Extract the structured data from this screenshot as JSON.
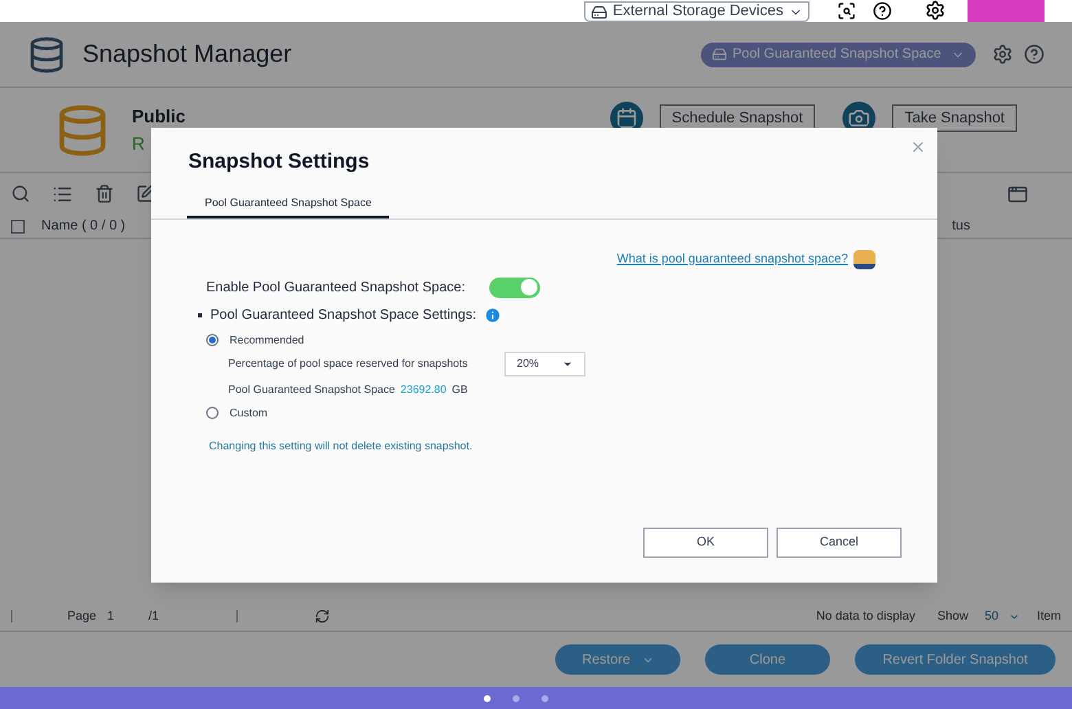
{
  "top_bar": {
    "storage_dropdown": "External Storage Devices"
  },
  "app": {
    "title": "Snapshot Manager",
    "pool_selector": "Pool Guaranteed Snapshot Space",
    "folder": {
      "name": "Public",
      "status": "R"
    },
    "buttons": [
      "Schedule Snapshot",
      "Take Snapshot"
    ],
    "table": {
      "select_all_checked": false,
      "columns": [
        "Name ( 0 / 0 )",
        "tus"
      ]
    },
    "pagination": {
      "page_label": "Page",
      "page": "1",
      "total": "/1",
      "status": "No data to display",
      "show_label": "Show",
      "show_value": "50",
      "items_label": "Item"
    },
    "actions": [
      {
        "label": "Restore",
        "dropdown": true
      },
      {
        "label": "Clone",
        "dropdown": false
      },
      {
        "label": "Revert Folder Snapshot",
        "dropdown": false
      }
    ]
  },
  "dialog": {
    "title": "Snapshot Settings",
    "tabs": [
      {
        "label": "Pool Guaranteed Snapshot Space",
        "selected": true
      }
    ],
    "help_link": "What is pool guaranteed snapshot space?",
    "enable": {
      "label": "Enable Pool Guaranteed Snapshot Space:",
      "on": true
    },
    "settings_label": "Pool Guaranteed Snapshot Space Settings:",
    "options": [
      {
        "label": "Recommended",
        "selected": true
      },
      {
        "label": "Custom",
        "selected": false
      }
    ],
    "percentage_label": "Percentage of pool space reserved for snapshots",
    "percentage_value": "20%",
    "space_label": "Pool Guaranteed Snapshot Space",
    "space_value": "23692.80",
    "space_unit": "GB",
    "note": "Changing this setting will not delete existing snapshot.",
    "buttons": [
      "OK",
      "Cancel"
    ]
  },
  "taskbar": {
    "pages": [
      {
        "selected": true
      },
      {
        "selected": false
      },
      {
        "selected": false
      }
    ]
  }
}
